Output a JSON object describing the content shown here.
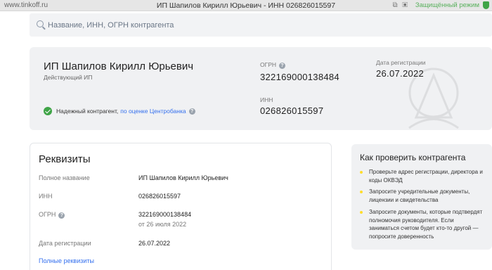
{
  "browser": {
    "url": "www.tinkoff.ru",
    "title": "ИП Шапилов Кирилл Юрьевич - ИНН 026826015597",
    "mode": "Защищённый режим"
  },
  "search": {
    "placeholder": "Название, ИНН, ОГРН контрагента"
  },
  "header": {
    "name": "ИП Шапилов Кирилл Юрьевич",
    "status": "Действующий ИП",
    "reliable_text": "Надежный контрагент,",
    "reliable_link": "по оценке Центробанка",
    "ogrn_label": "ОГРН",
    "ogrn_value": "322169000138484",
    "inn_label": "ИНН",
    "inn_value": "026826015597",
    "reg_label": "Дата регистрации",
    "reg_value": "26.07.2022"
  },
  "requisites": {
    "title": "Реквизиты",
    "rows": [
      {
        "label": "Полное название",
        "value": "ИП Шапилов Кирилл Юрьевич"
      },
      {
        "label": "ИНН",
        "value": "026826015597"
      },
      {
        "label": "ОГРН",
        "value": "322169000138484",
        "sub": "от 26 июля 2022"
      },
      {
        "label": "Дата регистрации",
        "value": "26.07.2022"
      }
    ],
    "link": "Полные реквизиты"
  },
  "check": {
    "title": "Как проверить контрагента",
    "tips": [
      "Проверьте адрес регистрации, директора и коды ОКВЭД",
      "Запросите учредительные документы, лицензии и свидетельства",
      "Запросите документы, которые подтвердят полномочия руководителя. Если заниматься счетом будет кто-то другой — попросите доверенность"
    ],
    "bullet_color": "#ffdd2d"
  },
  "colors": {
    "accent_link": "#336fee",
    "success": "#3fa447"
  }
}
